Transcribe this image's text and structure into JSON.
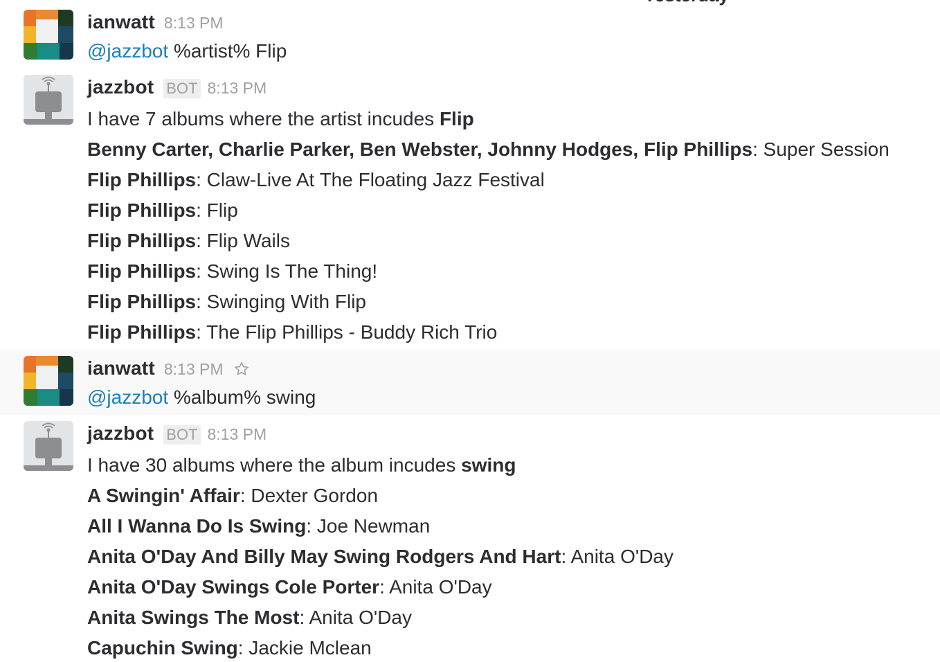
{
  "day_divider": "Yesterday",
  "messages": [
    {
      "user": "ianwatt",
      "time": "8:13 PM",
      "mention": "@jazzbot",
      "text": " %artist% Flip"
    },
    {
      "user": "jazzbot",
      "badge": "BOT",
      "time": "8:13 PM",
      "intro": "I have 7 albums where the artist incudes ",
      "intro_bold": "Flip",
      "rows": [
        {
          "bold": "Benny Carter, Charlie Parker, Ben Webster, Johnny Hodges, Flip Phillips",
          "rest": ": Super Session"
        },
        {
          "bold": "Flip Phillips",
          "rest": ": Claw-Live At The Floating Jazz Festival"
        },
        {
          "bold": "Flip Phillips",
          "rest": ": Flip"
        },
        {
          "bold": "Flip Phillips",
          "rest": ": Flip Wails"
        },
        {
          "bold": "Flip Phillips",
          "rest": ": Swing Is The Thing!"
        },
        {
          "bold": "Flip Phillips",
          "rest": ": Swinging With Flip"
        },
        {
          "bold": "Flip Phillips",
          "rest": ": The Flip Phillips - Buddy Rich Trio"
        }
      ]
    },
    {
      "user": "ianwatt",
      "time": "8:13 PM",
      "star_icon": "star-outline-icon",
      "mention": "@jazzbot",
      "text": " %album% swing"
    },
    {
      "user": "jazzbot",
      "badge": "BOT",
      "time": "8:13 PM",
      "intro": "I have 30 albums where the album incudes ",
      "intro_bold": "swing",
      "rows": [
        {
          "bold": "A Swingin' Affair",
          "rest": ": Dexter Gordon"
        },
        {
          "bold": "All I Wanna Do Is Swing",
          "rest": ": Joe Newman"
        },
        {
          "bold": "Anita O'Day And Billy May Swing Rodgers And Hart",
          "rest": ": Anita O'Day"
        },
        {
          "bold": "Anita O'Day Swings Cole Porter",
          "rest": ": Anita O'Day"
        },
        {
          "bold": "Anita Swings The Most",
          "rest": ": Anita O'Day"
        },
        {
          "bold": "Capuchin Swing",
          "rest": ": Jackie Mclean"
        }
      ]
    }
  ],
  "colors": {
    "mention": "#1d7fbe",
    "timestamp": "#a0a0a2",
    "highlight_bg": "#f9f9f9"
  }
}
